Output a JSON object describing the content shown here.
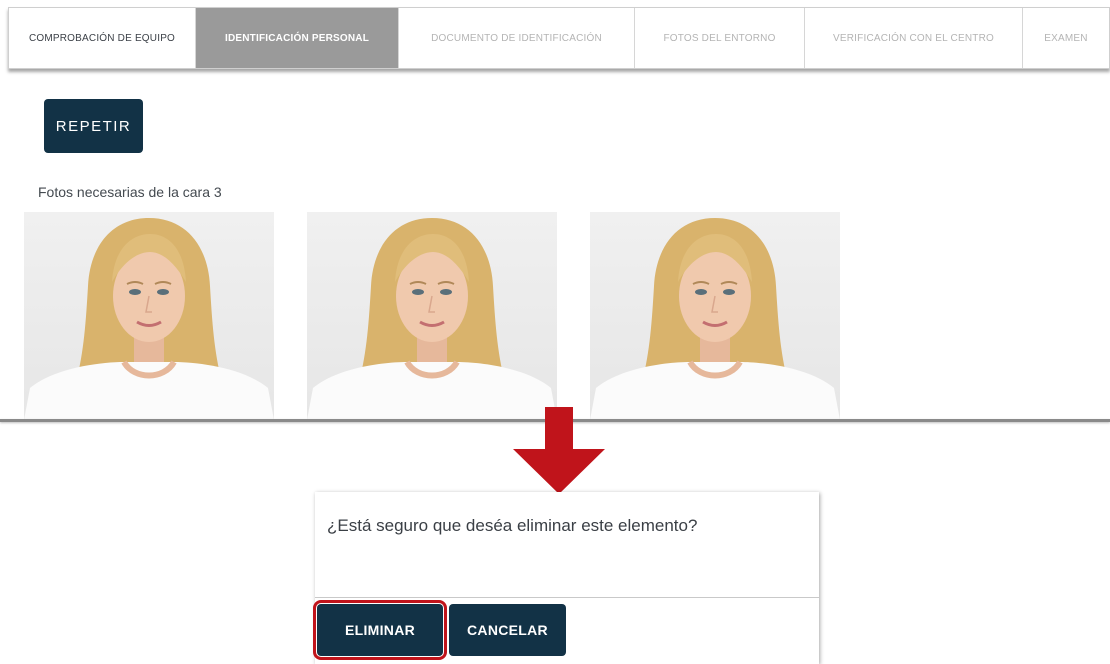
{
  "steps": [
    {
      "label": "COMPROBACIÓN DE EQUIPO",
      "state": "done"
    },
    {
      "label": "IDENTIFICACIÓN PERSONAL",
      "state": "active"
    },
    {
      "label": "DOCUMENTO DE IDENTIFICACIÓN",
      "state": "pending"
    },
    {
      "label": "FOTOS DEL ENTORNO",
      "state": "pending"
    },
    {
      "label": "VERIFICACIÓN CON EL CENTRO",
      "state": "pending"
    },
    {
      "label": "EXAMEN",
      "state": "pending"
    }
  ],
  "repeat_button": {
    "label": "REPETIR"
  },
  "faces_section": {
    "label": "Fotos necesarias de la cara 3",
    "photos": [
      {
        "name": "face-photo-1"
      },
      {
        "name": "face-photo-2"
      },
      {
        "name": "face-photo-3"
      }
    ]
  },
  "dialog": {
    "message": "¿Está seguro que deséa eliminar este elemento?",
    "confirm_label": "ELIMINAR",
    "cancel_label": "CANCELAR"
  },
  "colors": {
    "primary_dark": "#123246",
    "active_tab": "#9a9a9a",
    "highlight": "#c0141b",
    "arrow": "#c0141b"
  },
  "icons": {
    "arrow": "down-arrow-icon"
  }
}
